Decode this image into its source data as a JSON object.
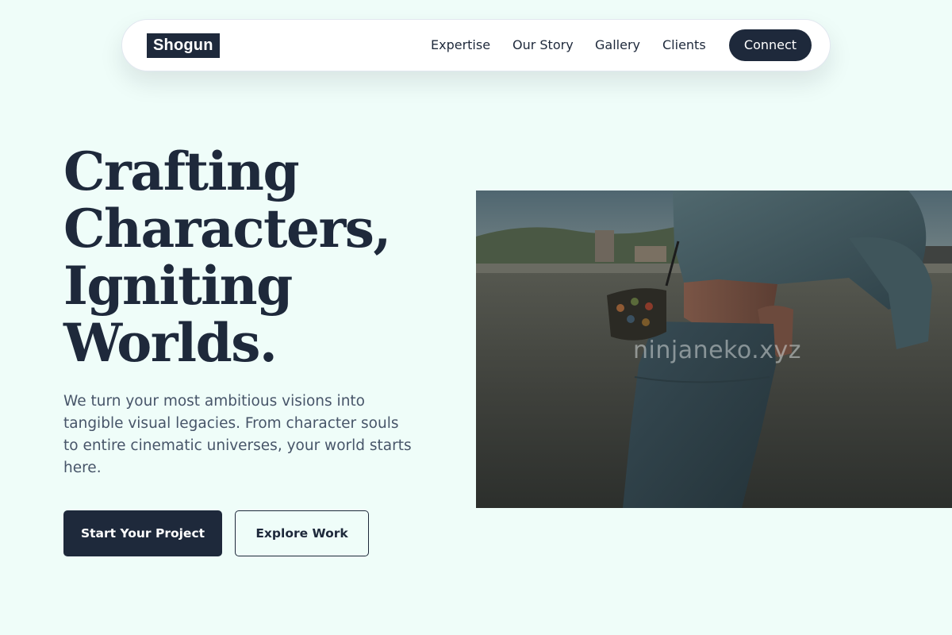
{
  "nav": {
    "logo": "Shogun",
    "links": [
      "Expertise",
      "Our Story",
      "Gallery",
      "Clients"
    ],
    "cta": "Connect"
  },
  "hero": {
    "headline_lines": [
      "Crafting",
      "Characters,",
      "Igniting",
      "Worlds."
    ],
    "subtitle": "We turn your most ambitious visions into tangible visual legacies. From character souls to entire cinematic universes, your world starts here.",
    "primary_button": "Start Your Project",
    "secondary_button": "Explore Work",
    "image_watermark": "ninjaneko.xyz"
  },
  "colors": {
    "background": "#effdf9",
    "primary": "#1e293b",
    "text_muted": "#475569",
    "surface": "#ffffff"
  },
  "icons": []
}
